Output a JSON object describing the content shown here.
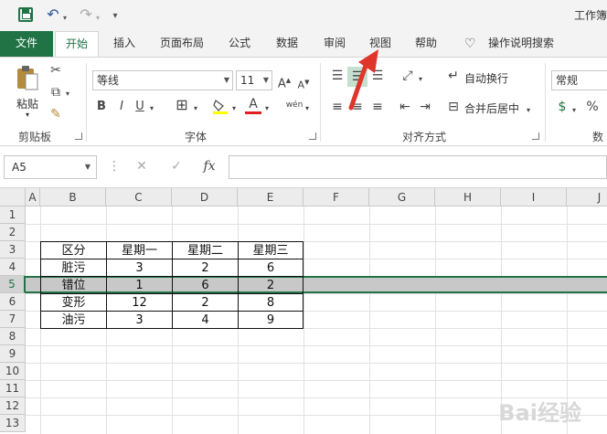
{
  "title": "工作簿",
  "qat": {
    "undo_icon": "↶",
    "redo_icon": "↷",
    "customize_icon": "▾"
  },
  "tabs": [
    "文件",
    "开始",
    "插入",
    "页面布局",
    "公式",
    "数据",
    "审阅",
    "视图",
    "帮助",
    "操作说明搜索"
  ],
  "ribbon": {
    "clipboard": {
      "paste_label": "粘贴",
      "group_label": "剪贴板"
    },
    "font": {
      "font_name": "等线",
      "font_size": "11",
      "bold": "B",
      "italic": "I",
      "underline": "U",
      "group_label": "字体",
      "phonetic": "wén"
    },
    "alignment": {
      "wrap_text": "自动换行",
      "merge_center": "合并后居中",
      "group_label": "对齐方式"
    },
    "number": {
      "format": "常规",
      "percent": "%",
      "group_label": "数字"
    }
  },
  "formula_bar": {
    "name_box": "A5",
    "fx": "fx",
    "value": ""
  },
  "columns": [
    "A",
    "B",
    "C",
    "D",
    "E",
    "F",
    "G",
    "H",
    "I",
    "J"
  ],
  "rows": [
    "1",
    "2",
    "3",
    "4",
    "5",
    "6",
    "7",
    "8",
    "9",
    "10",
    "11",
    "12",
    "13"
  ],
  "selected_row": "5",
  "table": {
    "header": [
      "区分",
      "星期一",
      "星期二",
      "星期三"
    ],
    "rows": [
      [
        "脏污",
        "3",
        "2",
        "6"
      ],
      [
        "错位",
        "1",
        "6",
        "2"
      ],
      [
        "变形",
        "12",
        "2",
        "8"
      ],
      [
        "油污",
        "3",
        "4",
        "9"
      ]
    ]
  },
  "watermark": "Bai经验"
}
